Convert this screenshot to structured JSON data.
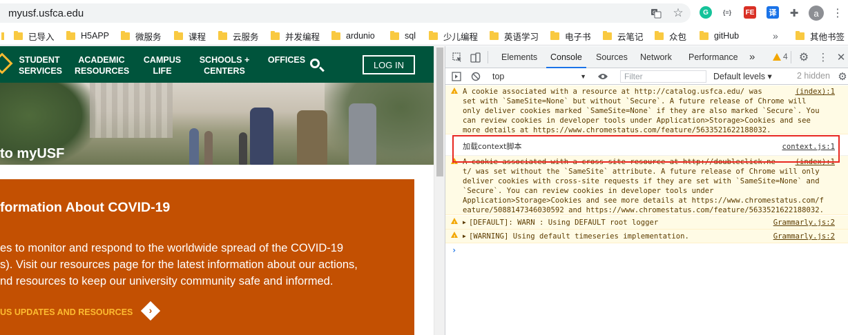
{
  "browser": {
    "url": "myusf.usfca.edu",
    "avatar_letter": "a",
    "ext_json_label": "{≡}",
    "ext_fe_label": "FE",
    "ext_translate_label": "译",
    "bookmarks": [
      "已导入",
      "H5APP",
      "微服务",
      "课程",
      "云服务",
      "并发编程",
      "ardunio",
      "sql",
      "少儿编程",
      "英语学习",
      "电子书",
      "云笔记",
      "众包",
      "gitHub"
    ],
    "more_chevron": "»",
    "other_bookmarks": "其他书签"
  },
  "site": {
    "nav": [
      {
        "line1": "STUDENT",
        "line2": "SERVICES"
      },
      {
        "line1": "ACADEMIC",
        "line2": "RESOURCES"
      },
      {
        "line1": "CAMPUS",
        "line2": "LIFE"
      },
      {
        "line1": "SCHOOLS +",
        "line2": "CENTERS"
      },
      {
        "line1": "OFFICES",
        "line2": ""
      }
    ],
    "login_label": "LOG IN",
    "hero_caption": "to myUSF",
    "covid": {
      "title": "formation About COVID-19",
      "body_lines": [
        "es to monitor and respond to the worldwide spread of the COVID-19",
        "s). Visit our resources page for the latest information about our actions,",
        "nd resources to keep our university community safe and informed."
      ],
      "link": "US UPDATES AND RESOURCES",
      "arrow": "›"
    }
  },
  "devtools": {
    "tabs": [
      "Elements",
      "Console",
      "Sources",
      "Network",
      "Performance"
    ],
    "active_tab": "Console",
    "more_tabs": "»",
    "warning_count": "4",
    "context": "top",
    "filter_placeholder": "Filter",
    "levels": "Default levels ▾",
    "hidden": "2 hidden",
    "messages": [
      {
        "kind": "warn",
        "lines": [
          "A cookie associated with a resource at http://catalog.usfca.edu/ was",
          "set with `SameSite=None` but without `Secure`. A future release of Chrome will",
          "only deliver cookies marked `SameSite=None` if they are also marked `Secure`. You",
          "can review cookies in developer tools under Application>Storage>Cookies and see",
          "more details at https://www.chromestatus.com/feature/5633521622188032."
        ],
        "source": "(index):1"
      },
      {
        "kind": "plain",
        "lines": [
          "加载context脚本"
        ],
        "source": "context.js:1"
      },
      {
        "kind": "warn",
        "lines": [
          "A cookie associated with a cross-site resource at http://doubleclick.ne",
          "t/ was set without the `SameSite` attribute. A future release of Chrome will only",
          "deliver cookies with cross-site requests if they are set with `SameSite=None` and",
          "`Secure`. You can review cookies in developer tools under",
          "Application>Storage>Cookies and see more details at https://www.chromestatus.com/f",
          "eature/5088147346030592 and https://www.chromestatus.com/feature/5633521622188032."
        ],
        "source": "(index):1"
      },
      {
        "kind": "warn",
        "lines": [
          "[DEFAULT]: WARN : Using DEFAULT root logger"
        ],
        "source": "Grammarly.js:2"
      },
      {
        "kind": "warn",
        "lines": [
          "[WARNING] Using default timeseries implementation."
        ],
        "source": "Grammarly.js:2"
      }
    ],
    "prompt": "›"
  },
  "colors": {
    "usf_green": "#00543c",
    "usf_orange": "#c35002",
    "usf_gold": "#fdbb30",
    "warn_bg": "#fffbe5",
    "highlight": "#e8271f"
  }
}
